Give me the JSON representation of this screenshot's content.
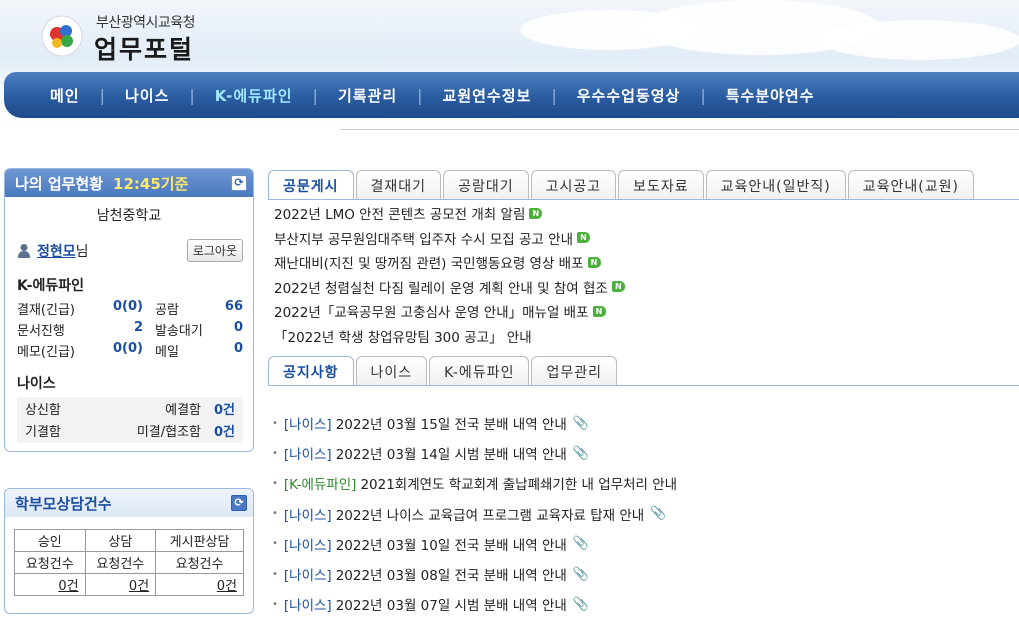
{
  "header": {
    "org_name": "부산광역시교육청",
    "title": "업무포털"
  },
  "nav": {
    "items": [
      "메인",
      "나이스",
      "K-에듀파인",
      "기록관리",
      "교원연수정보",
      "우수수업동영상",
      "특수분야연수"
    ],
    "active_index": 2
  },
  "status_panel": {
    "title": "나의 업무현황",
    "time": "12:45기준",
    "school": "남천중학교",
    "user_name": "정현모",
    "user_suffix": "님",
    "logout_label": "로그아웃",
    "kedufine_title": "K-에듀파인",
    "rows": [
      {
        "label": "결재(긴급)",
        "value": "0(0)",
        "label2": "공람",
        "value2": "66"
      },
      {
        "label": "문서진행",
        "value": "2",
        "label2": "발송대기",
        "value2": "0"
      },
      {
        "label": "메모(긴급)",
        "value": "0(0)",
        "label2": "메일",
        "value2": "0"
      }
    ],
    "neis_title": "나이스",
    "neis_rows": [
      {
        "label": "상신함",
        "label2": "예결함",
        "value": "0건"
      },
      {
        "label": "기결함",
        "label2": "미결/협조함",
        "value": "0건"
      }
    ]
  },
  "counsel_panel": {
    "title": "학부모상담건수",
    "headers": [
      [
        "승인",
        "요청건수"
      ],
      [
        "상담",
        "요청건수"
      ],
      [
        "게시판상담",
        "요청건수"
      ]
    ],
    "values": [
      "0건",
      "0건",
      "0건"
    ]
  },
  "doc_tabs": {
    "items": [
      "공문게시",
      "결재대기",
      "공람대기",
      "고시공고",
      "보도자료",
      "교육안내(일반직)",
      "교육안내(교원)"
    ],
    "active_index": 0
  },
  "doc_list": [
    {
      "text": "2022년 LMO 안전 콘텐츠 공모전 개최 알림",
      "new": true
    },
    {
      "text": "부산지부 공무원임대주택 입주자 수시 모집 공고 안내",
      "new": true
    },
    {
      "text": "재난대비(지진 및 땅꺼짐 관련) 국민행동요령 영상 배포",
      "new": true
    },
    {
      "text": "2022년 청렴실천 다짐 릴레이 운영 계획 안내 및 참여 협조",
      "new": true
    },
    {
      "text": "2022년「교육공무원 고충심사 운영 안내」매뉴얼 배포",
      "new": true
    },
    {
      "text": "「2022년 학생 창업유망팀 300 공고」 안내",
      "new": false
    }
  ],
  "notice_tabs": {
    "items": [
      "공지사항",
      "나이스",
      "K-에듀파인",
      "업무관리"
    ],
    "active_index": 0
  },
  "notice_list": [
    {
      "category": "[나이스]",
      "text": "2022년 03월 15일 전국 분배 내역 안내",
      "clip": true
    },
    {
      "category": "[나이스]",
      "text": "2022년 03월 14일 시범 분배 내역 안내",
      "clip": true
    },
    {
      "category": "[K-에듀파인]",
      "text": "2021회계연도 학교회계 출납폐쇄기한 내 업무처리 안내",
      "clip": false
    },
    {
      "category": "[나이스]",
      "text": "2022년 나이스 교육급여 프로그램 교육자료 탑재 안내",
      "clip": true
    },
    {
      "category": "[나이스]",
      "text": "2022년 03월 10일 전국 분배 내역 안내",
      "clip": true
    },
    {
      "category": "[나이스]",
      "text": "2022년 03월 08일 전국 분배 내역 안내",
      "clip": true
    },
    {
      "category": "[나이스]",
      "text": "2022년 03월 07일 시범 분배 내역 안내",
      "clip": true
    }
  ],
  "icons": {
    "new_badge": "N",
    "clip": "paperclip-icon",
    "refresh": "refresh-icon",
    "user": "user-icon"
  },
  "colors": {
    "nav_bg": "#2c5ea3",
    "nav_active": "#9fe8ff",
    "link_blue": "#1a4fa0",
    "new_green": "#4caf3a",
    "status_time": "#ffe866"
  }
}
